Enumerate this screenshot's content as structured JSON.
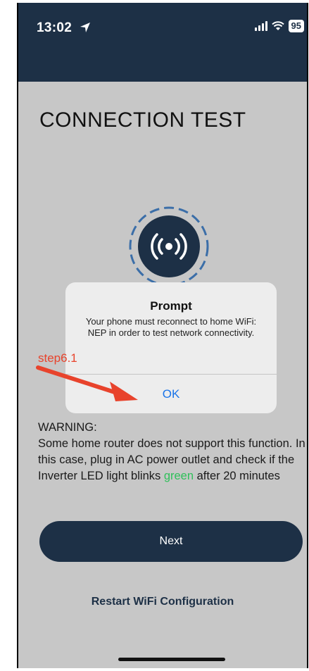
{
  "status_bar": {
    "time": "13:02",
    "battery": "95"
  },
  "page": {
    "title": "CONNECTION TEST"
  },
  "warning": {
    "heading": "WARNING:",
    "text_before": "Some home router does not support this function. In this case, plug in AC power outlet and check if the Inverter LED light blinks ",
    "highlight": "green",
    "text_after": " after 20 minutes",
    "highlight_color": "#2fc05a"
  },
  "buttons": {
    "next": "Next",
    "restart": "Restart WiFi Configuration"
  },
  "dialog": {
    "title": "Prompt",
    "message": "Your phone must reconnect to home WiFi: NEP in order to test network connectivity.",
    "ok": "OK"
  },
  "annotation": {
    "label": "step6.1",
    "color": "#e8432c"
  },
  "colors": {
    "primary": "#1d3046",
    "background": "#c7c7c7",
    "link": "#1a73e8"
  }
}
